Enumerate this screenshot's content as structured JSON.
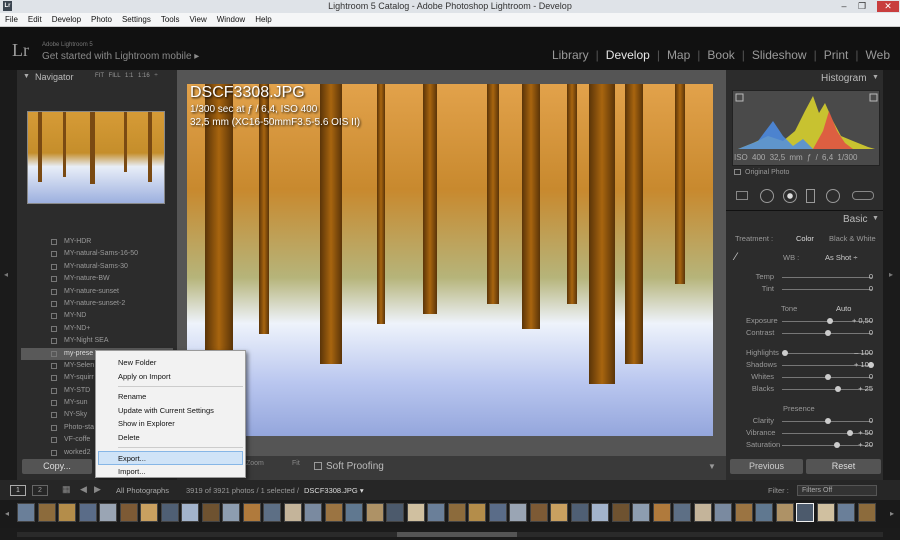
{
  "window": {
    "title": "Lightroom 5 Catalog - Adobe Photoshop Lightroom - Develop",
    "min": "–",
    "max": "❐",
    "close": "✕"
  },
  "menu": [
    "File",
    "Edit",
    "Develop",
    "Photo",
    "Settings",
    "Tools",
    "View",
    "Window",
    "Help"
  ],
  "brand": {
    "logo": "Lr",
    "version": "Adobe Lightroom 5",
    "mobile": "Get started with Lightroom mobile ▸"
  },
  "modules": [
    {
      "label": "Library",
      "active": false
    },
    {
      "label": "Develop",
      "active": true
    },
    {
      "label": "Map",
      "active": false
    },
    {
      "label": "Book",
      "active": false
    },
    {
      "label": "Slideshow",
      "active": false
    },
    {
      "label": "Print",
      "active": false
    },
    {
      "label": "Web",
      "active": false
    }
  ],
  "navigator": {
    "title": "Navigator",
    "zoom": "FIT  FILL  1:1  1:16 ÷"
  },
  "presets": [
    "MY-HDR",
    "MY-natural-Sams-16-50",
    "MY-natural-Sams-30",
    "MY-nature-BW",
    "MY-nature-sunset",
    "MY-nature-sunset-2",
    "MY-ND",
    "MY-ND+",
    "MY-Night SEA",
    "my-prese",
    "MY-Selen",
    "MY-squirr",
    "MY-STD",
    "MY-sun",
    "NY-Sky",
    "Photo-sta",
    "VF-coffe",
    "worked2"
  ],
  "presets_selected": 9,
  "context_menu": {
    "group1": [
      "New Folder",
      "Apply on Import"
    ],
    "group2": [
      "Rename",
      "Update with Current Settings",
      "Show in Explorer",
      "Delete"
    ],
    "group3": [
      "Export...",
      "Import..."
    ],
    "highlighted": "Export..."
  },
  "copy_button": "Copy...",
  "photo": {
    "filename": "DSCF3308.JPG",
    "exposure": "1/300 sec at ƒ / 6,4, ISO 400",
    "lens": "32,5 mm (XC16-50mmF3.5-5.6 OIS II)"
  },
  "toolbar": {
    "zoom": "Zoom",
    "fit": "Fit",
    "soft_proofing": "Soft Proofing"
  },
  "histogram": {
    "title": "Histogram",
    "stats": "ISO 400   32,5 mm  ƒ / 6,4    1/300",
    "original_photo": "Original Photo"
  },
  "basic": {
    "title": "Basic",
    "treatment_label": "Treatment :",
    "treatment_color": "Color",
    "treatment_bw": "Black & White",
    "wb_label": "WB :",
    "wb_value": "As Shot ÷",
    "temp": {
      "label": "Temp",
      "value": "0"
    },
    "tint": {
      "label": "Tint",
      "value": "0"
    },
    "tone_label": "Tone",
    "auto": "Auto",
    "sliders": [
      {
        "label": "Exposure",
        "value": "+ 0,50",
        "pos": 0.52
      },
      {
        "label": "Contrast",
        "value": "0",
        "pos": 0.5
      },
      {
        "label": "Highlights",
        "value": "– 100",
        "pos": 0.0
      },
      {
        "label": "Shadows",
        "value": "+ 100",
        "pos": 1.0
      },
      {
        "label": "Whites",
        "value": "0",
        "pos": 0.5
      },
      {
        "label": "Blacks",
        "value": "+ 25",
        "pos": 0.62
      }
    ],
    "presence_label": "Presence",
    "presence": [
      {
        "label": "Clarity",
        "value": "0",
        "pos": 0.5
      },
      {
        "label": "Vibrance",
        "value": "+ 50",
        "pos": 0.75
      },
      {
        "label": "Saturation",
        "value": "+ 20",
        "pos": 0.6
      }
    ]
  },
  "buttons": {
    "previous": "Previous",
    "reset": "Reset"
  },
  "filmstrip": {
    "page1": "1",
    "page2": "2",
    "source": "All Photographs",
    "count": "3919 of 3921 photos / 1 selected / ",
    "selected_file": "DSCF3308.JPG ▾",
    "filter_label": "Filter :",
    "filter_value": "Filters Off"
  },
  "colors": {
    "bg": "#1b1b1b",
    "panel": "#2c2c2c",
    "highlight": "#cfe3f7",
    "close": "#c83d3d"
  }
}
